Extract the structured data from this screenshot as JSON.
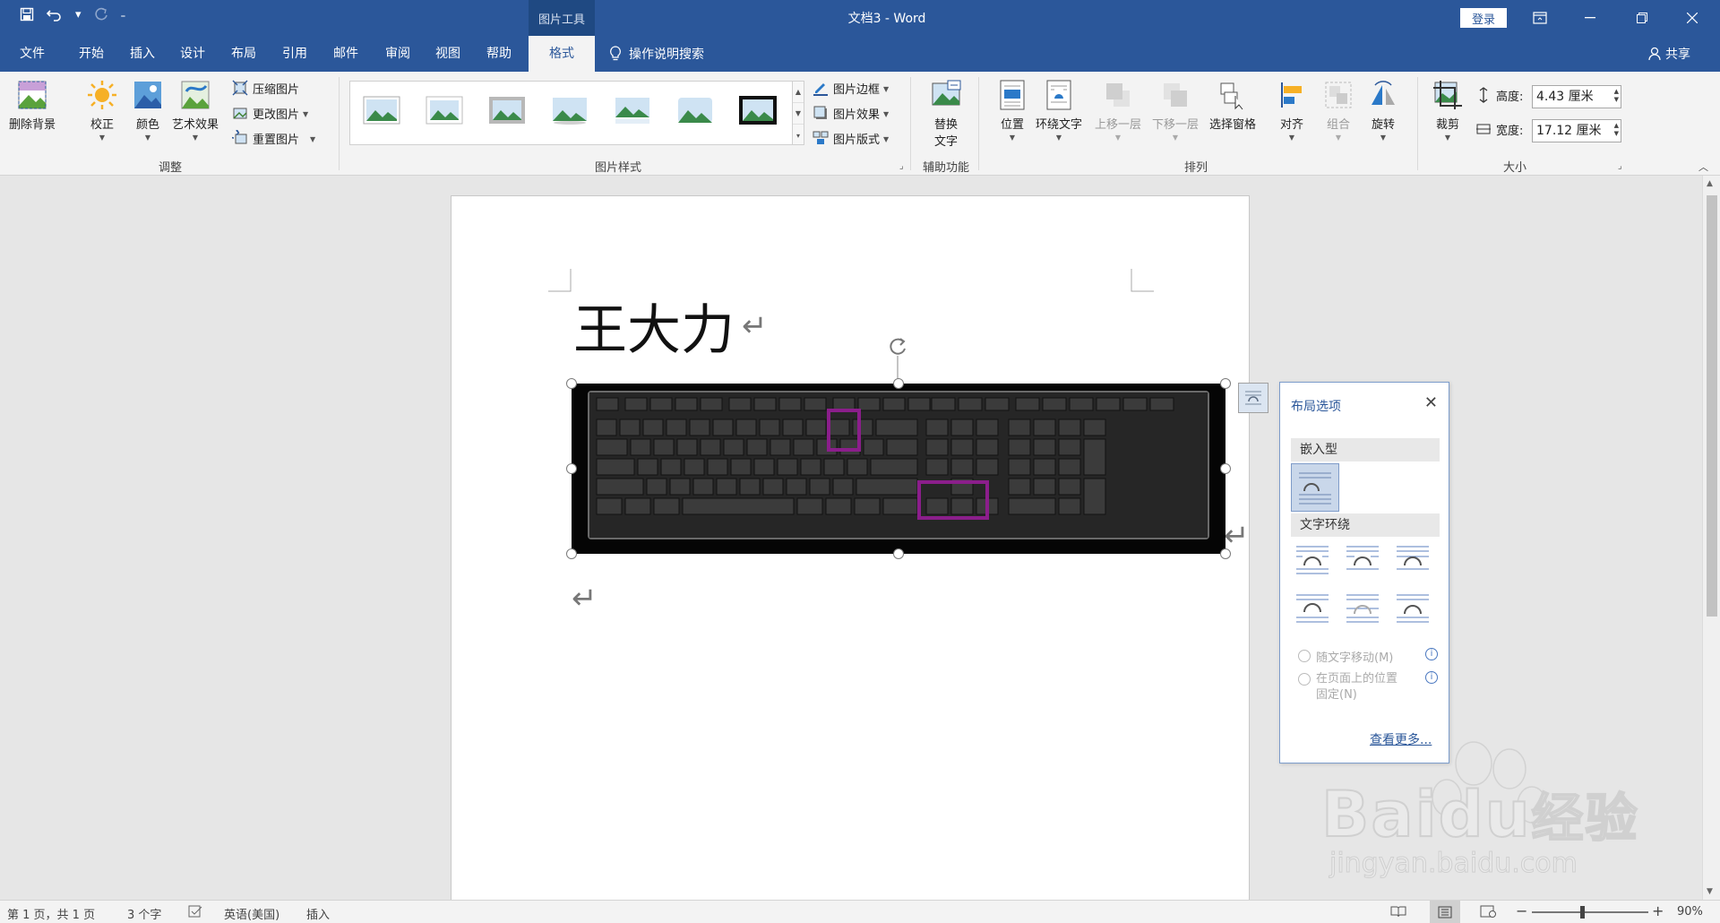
{
  "titlebar": {
    "context_tab": "图片工具",
    "doc_title": "文档3 - Word",
    "login": "登录"
  },
  "tabs": [
    {
      "label": "文件"
    },
    {
      "label": "开始"
    },
    {
      "label": "插入"
    },
    {
      "label": "设计"
    },
    {
      "label": "布局"
    },
    {
      "label": "引用"
    },
    {
      "label": "邮件"
    },
    {
      "label": "审阅"
    },
    {
      "label": "视图"
    },
    {
      "label": "帮助"
    },
    {
      "label": "格式"
    }
  ],
  "tell_me": "操作说明搜索",
  "share": "共享",
  "ribbon": {
    "adjust": {
      "remove_bg": "删除背景",
      "corrections": "校正",
      "color": "颜色",
      "artistic": "艺术效果",
      "compress": "压缩图片",
      "change": "更改图片",
      "reset": "重置图片",
      "group_label": "调整"
    },
    "styles": {
      "border": "图片边框",
      "effects": "图片效果",
      "layout": "图片版式",
      "group_label": "图片样式"
    },
    "accessibility": {
      "alt_text_line1": "替换",
      "alt_text_line2": "文字",
      "group_label": "辅助功能"
    },
    "arrange": {
      "position": "位置",
      "wrap_text": "环绕文字",
      "bring_forward": "上移一层",
      "send_backward": "下移一层",
      "selection_pane": "选择窗格",
      "align": "对齐",
      "group": "组合",
      "rotate": "旋转",
      "group_label": "排列"
    },
    "size": {
      "crop": "裁剪",
      "height_label": "高度:",
      "height_value": "4.43 厘米",
      "width_label": "宽度:",
      "width_value": "17.12 厘米",
      "group_label": "大小"
    }
  },
  "document": {
    "heading": "王大力"
  },
  "layout_pane": {
    "title": "布局选项",
    "inline_section": "嵌入型",
    "wrap_section": "文字环绕",
    "move_with_text": "随文字移动(M)",
    "fix_position_line1": "在页面上的位置",
    "fix_position_line2": "固定(N)",
    "see_more": "查看更多..."
  },
  "statusbar": {
    "page": "第 1 页，共 1 页",
    "words": "3 个字",
    "language": "英语(美国)",
    "mode": "插入",
    "zoom_label": "90%",
    "zoom_percent": 90
  },
  "watermark": {
    "brand": "Bai",
    "brand2": "du",
    "cn": "经验",
    "url": "jingyan.baidu.com"
  },
  "colors": {
    "accent": "#2b579a",
    "highlight_box": "#8b1e8b"
  }
}
